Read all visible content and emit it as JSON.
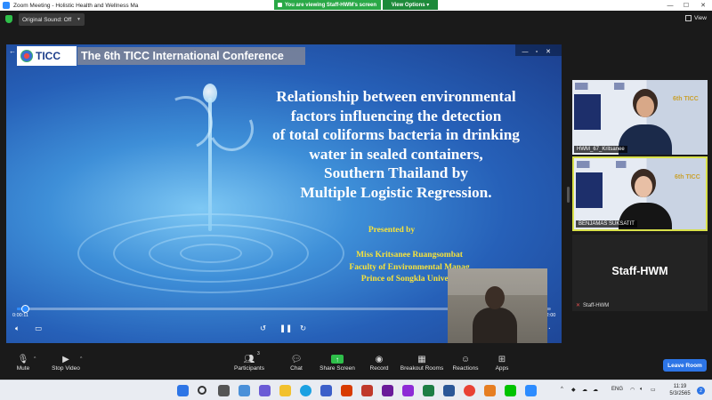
{
  "window": {
    "title": "Zoom Meeting - Holistic Health and Wellness Ma",
    "viewing_banner": "You are viewing Staff-HWM's screen",
    "view_options": "View Options",
    "minimize_icon": "minimize-icon",
    "maximize_icon": "maximize-icon",
    "close_icon": "close-icon"
  },
  "subbar": {
    "original_sound": "Original Sound: Off",
    "view_label": "View"
  },
  "slide": {
    "logo_text": "TICC",
    "conference_title": "The 6th TICC International Conference",
    "title_lines": [
      "Relationship between environmental",
      "factors influencing the detection",
      "of total coliforms bacteria in drinking",
      "water in sealed containers,",
      "Southern Thailand by",
      "Multiple Logistic Regression."
    ],
    "presented_by": "Presented by",
    "presenter_lines": [
      "Miss Kritsanee Ruangsombat",
      "Faculty of Environmental Manag",
      "Prince of Songkla Universi"
    ]
  },
  "player": {
    "current_time": "0:00:11",
    "total_time": "0:12:00",
    "progress": 0.015
  },
  "participants": [
    {
      "name": "HWM_67_Kritsanee",
      "active": false
    },
    {
      "name": "BENJAMAS SUKSATIT",
      "active": true
    }
  ],
  "staff_tile": {
    "big_name": "Staff-HWM",
    "small_name": "Staff-HWM"
  },
  "toolbar": {
    "mute": "Mute",
    "stop_video": "Stop Video",
    "participants": "Participants",
    "participants_count": "3",
    "chat": "Chat",
    "share_screen": "Share Screen",
    "record": "Record",
    "breakout_rooms": "Breakout Rooms",
    "reactions": "Reactions",
    "apps": "Apps",
    "leave": "Leave Room"
  },
  "taskbar": {
    "lang": "ENG",
    "time": "11:19",
    "date": "5/3/2565",
    "notif_count": "2"
  },
  "colors": {
    "zoom_blue": "#2d8cff",
    "banner_green": "#2aa847",
    "slide_yellow": "#f7e23a",
    "active_border": "#d8e04a"
  }
}
